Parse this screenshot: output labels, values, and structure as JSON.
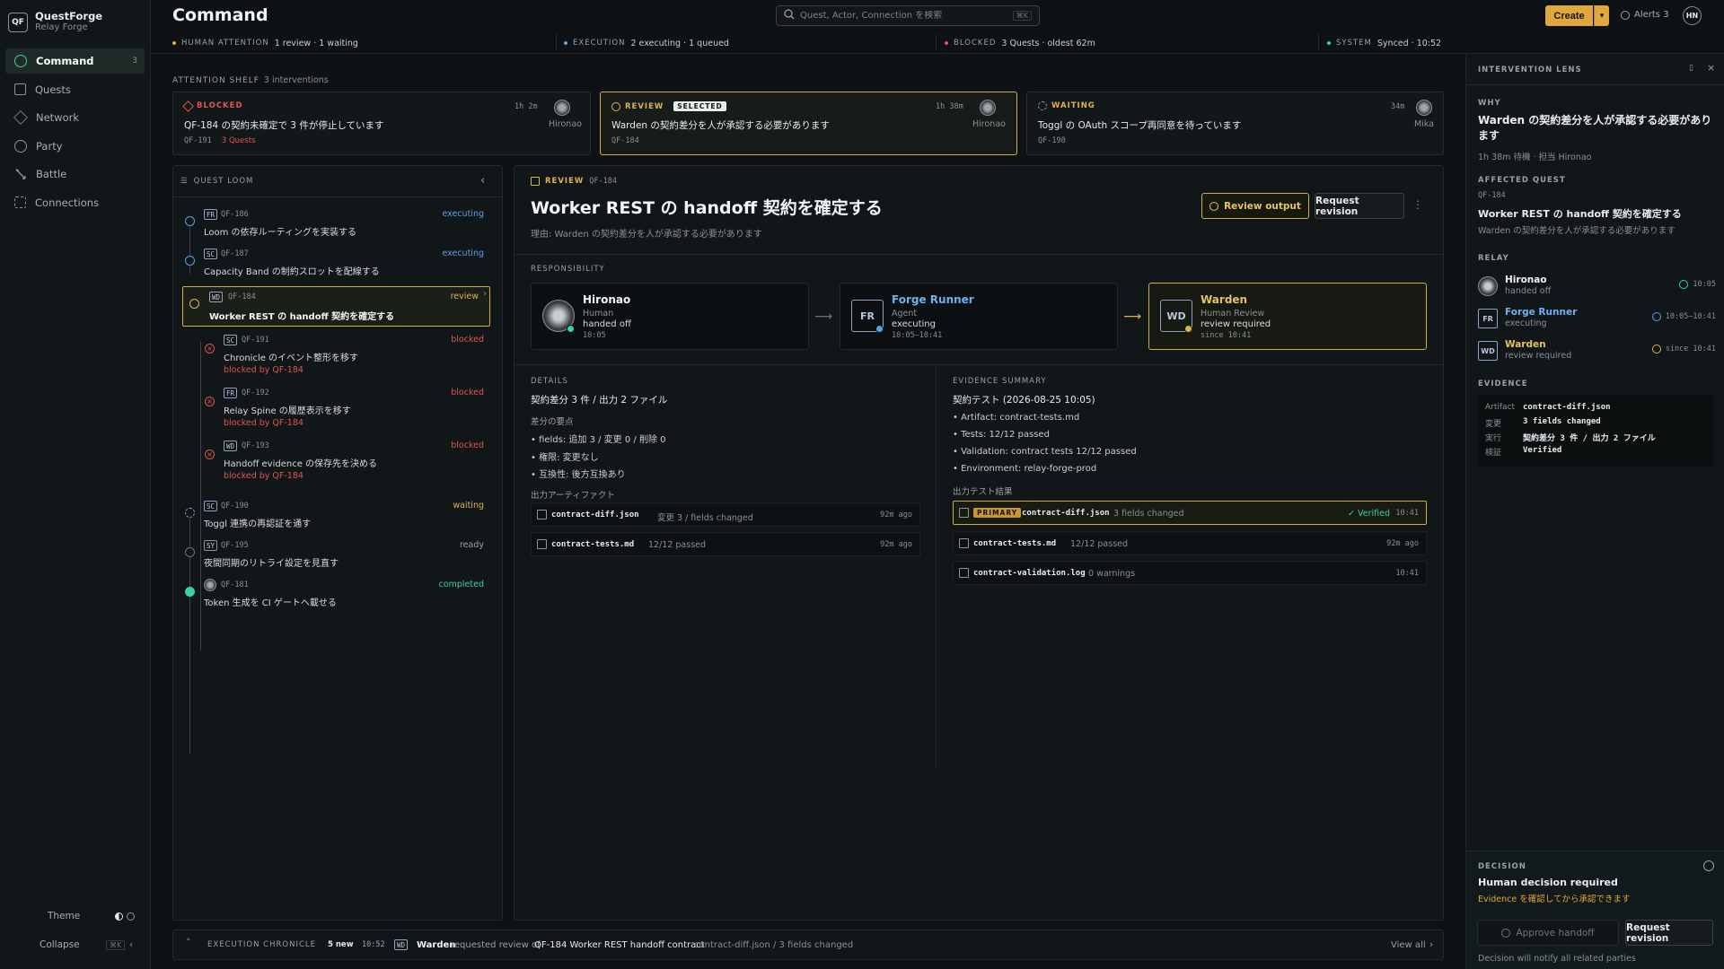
{
  "brand": {
    "logo": "QF",
    "name": "QuestForge",
    "sub": "Relay Forge"
  },
  "sidebar": {
    "items": [
      {
        "label": "Command",
        "icon": "command-icon",
        "badge": "3",
        "active": true
      },
      {
        "label": "Quests",
        "icon": "quests-icon"
      },
      {
        "label": "Network",
        "icon": "network-icon"
      },
      {
        "label": "Party",
        "icon": "party-icon"
      },
      {
        "label": "Battle",
        "icon": "battle-icon"
      },
      {
        "label": "Connections",
        "icon": "connections-icon"
      }
    ],
    "theme_label": "Theme",
    "collapse_label": "Collapse",
    "collapse_kbd": "⌘K"
  },
  "header": {
    "title": "Command",
    "search_placeholder": "Quest, Actor, Connection を検索",
    "search_kbd": "⌘K",
    "create_label": "Create",
    "alerts_label": "Alerts 3",
    "avatar": "HN"
  },
  "status": {
    "human": {
      "key": "HUMAN ATTENTION",
      "value": "1 review · 1 waiting"
    },
    "execution": {
      "key": "EXECUTION",
      "value": "2 executing · 1 queued"
    },
    "blocked": {
      "key": "BLOCKED",
      "value": "3 Quests · oldest 62m"
    },
    "system": {
      "key": "SYSTEM",
      "value": "Synced · 10:52"
    }
  },
  "shelf": {
    "label": "ATTENTION SHELF",
    "count": "3 interventions",
    "cards": [
      {
        "type": "BLOCKED",
        "time": "1h 2m",
        "who": "Hironao",
        "title": "QF-184 の契約未確定で 3 件が停止しています",
        "id": "QF-191",
        "extra": "3 Quests"
      },
      {
        "type": "REVIEW",
        "badge": "SELECTED",
        "time": "1h 38m",
        "who": "Hironao",
        "title": "Warden の契約差分を人が承認する必要があります",
        "id": "QF-184"
      },
      {
        "type": "WAITING",
        "time": "34m",
        "who": "Mika",
        "title": "Toggl の OAuth スコープ再同意を待っています",
        "id": "QF-190"
      }
    ]
  },
  "loom": {
    "title": "QUEST LOOM",
    "items": [
      {
        "tag": "FR",
        "id": "QF-186",
        "title": "Loom の依存ルーティングを実装する",
        "state": "executing"
      },
      {
        "tag": "SC",
        "id": "QF-187",
        "title": "Capacity Band の制約スロットを配線する",
        "state": "executing"
      },
      {
        "tag": "WD",
        "id": "QF-184",
        "title": "Worker REST の handoff 契約を確定する",
        "state": "review"
      },
      {
        "tag": "SC",
        "id": "QF-191",
        "title": "Chronicle のイベント整形を移す",
        "state": "blocked",
        "blocked_by": "blocked by QF-184"
      },
      {
        "tag": "FR",
        "id": "QF-192",
        "title": "Relay Spine の履歴表示を移す",
        "state": "blocked",
        "blocked_by": "blocked by QF-184"
      },
      {
        "tag": "WD",
        "id": "QF-193",
        "title": "Handoff evidence の保存先を決める",
        "state": "blocked",
        "blocked_by": "blocked by QF-184"
      },
      {
        "tag": "SC",
        "id": "QF-190",
        "title": "Toggl 連携の再認証を通す",
        "state": "waiting"
      },
      {
        "tag": "SY",
        "id": "QF-195",
        "title": "夜間同期のリトライ設定を見直す",
        "state": "ready"
      },
      {
        "tag": "",
        "id": "QF-181",
        "title": "Token 生成を CI ゲートへ載せる",
        "state": "completed"
      }
    ]
  },
  "main": {
    "kind": "REVIEW",
    "id": "QF-184",
    "title": "Worker REST の handoff 契約を確定する",
    "reason": "理由: Warden の契約差分を人が承認する必要があります",
    "review_btn": "Review output",
    "revision_btn": "Request revision",
    "responsibility_label": "RESPONSIBILITY",
    "resp": [
      {
        "badge": "",
        "name": "Hironao",
        "role": "Human",
        "status": "handed off",
        "time": "10:05"
      },
      {
        "badge": "FR",
        "name": "Forge Runner",
        "role": "Agent",
        "status": "executing",
        "time": "10:05–10:41"
      },
      {
        "badge": "WD",
        "name": "Warden",
        "role": "Human Review",
        "status": "review required",
        "time": "since 10:41"
      }
    ],
    "details": {
      "label": "DETAILS",
      "headline": "契約差分 3 件 / 出力 2 ファイル",
      "sub_label": "差分の要点",
      "bullets": [
        "fields: 追加 3 / 変更 0 / 削除 0",
        "権限: 変更なし",
        "互換性: 後方互換あり"
      ],
      "artifacts_label": "出力アーティファクト",
      "artifacts": [
        {
          "name": "contract-diff.json",
          "note": "変更 3 / fields changed",
          "time": "92m ago"
        },
        {
          "name": "contract-tests.md",
          "note": "12/12 passed",
          "time": "92m ago"
        }
      ]
    },
    "evidence": {
      "label": "EVIDENCE SUMMARY",
      "headline": "契約テスト (2026-08-25 10:05)",
      "bullets": [
        "Artifact: contract-tests.md",
        "Tests: 12/12 passed",
        "Validation: contract tests 12/12 passed",
        "Environment: relay-forge-prod"
      ],
      "results_label": "出力テスト結果",
      "results": [
        {
          "badge": "PRIMARY",
          "name": "contract-diff.json",
          "note": "3 fields changed",
          "verified": "✓ Verified",
          "time": "10:41"
        },
        {
          "name": "contract-tests.md",
          "note": "12/12 passed",
          "time": "92m ago"
        },
        {
          "name": "contract-validation.log",
          "note": "0 warnings",
          "time": "10:41"
        }
      ]
    }
  },
  "lens": {
    "title": "INTERVENTION LENS",
    "why_label": "WHY",
    "why_text": "Warden の契約差分を人が承認する必要があります",
    "why_sub": "1h 38m 待機 · 担当 Hironao",
    "affected_label": "AFFECTED QUEST",
    "affected_id": "QF-184",
    "affected_title": "Worker REST の handoff 契約を確定する",
    "affected_sub": "Warden の契約差分を人が承認する必要があります",
    "relay_label": "RELAY",
    "relay": [
      {
        "badge": "",
        "name": "Hironao",
        "status": "handed off",
        "time": "10:05"
      },
      {
        "badge": "FR",
        "name": "Forge Runner",
        "status": "executing",
        "time": "10:05–10:41"
      },
      {
        "badge": "WD",
        "name": "Warden",
        "status": "review required",
        "time": "since 10:41"
      }
    ],
    "evidence_label": "EVIDENCE",
    "evidence": [
      {
        "k": "Artifact",
        "v": "contract-diff.json"
      },
      {
        "k": "変更",
        "v": "3 fields changed"
      },
      {
        "k": "実行",
        "v": "契約差分 3 件 / 出力 2 ファイル"
      },
      {
        "k": "検証",
        "v": "Verified"
      }
    ],
    "decision_label": "DECISION",
    "decision_title": "Human decision required",
    "decision_sub": "Evidence を確認してから承認できます",
    "approve_btn": "Approve handoff",
    "request_btn": "Request revision",
    "decision_note": "Decision will notify all related parties"
  },
  "chronicle": {
    "label": "EXECUTION CHRONICLE",
    "new_count": "5 new",
    "time": "10:52",
    "tag": "WD",
    "actor": "Warden",
    "text1": "requested review of",
    "quest": "QF-184 Worker REST handoff contract",
    "detail": "contract-diff.json / 3 fields changed",
    "view_all": "View all"
  },
  "colors": {
    "accent": "#e0a73e",
    "success": "#38d39f",
    "danger": "#e05550",
    "info": "#5aa0e6",
    "warn": "#e0b24e"
  }
}
